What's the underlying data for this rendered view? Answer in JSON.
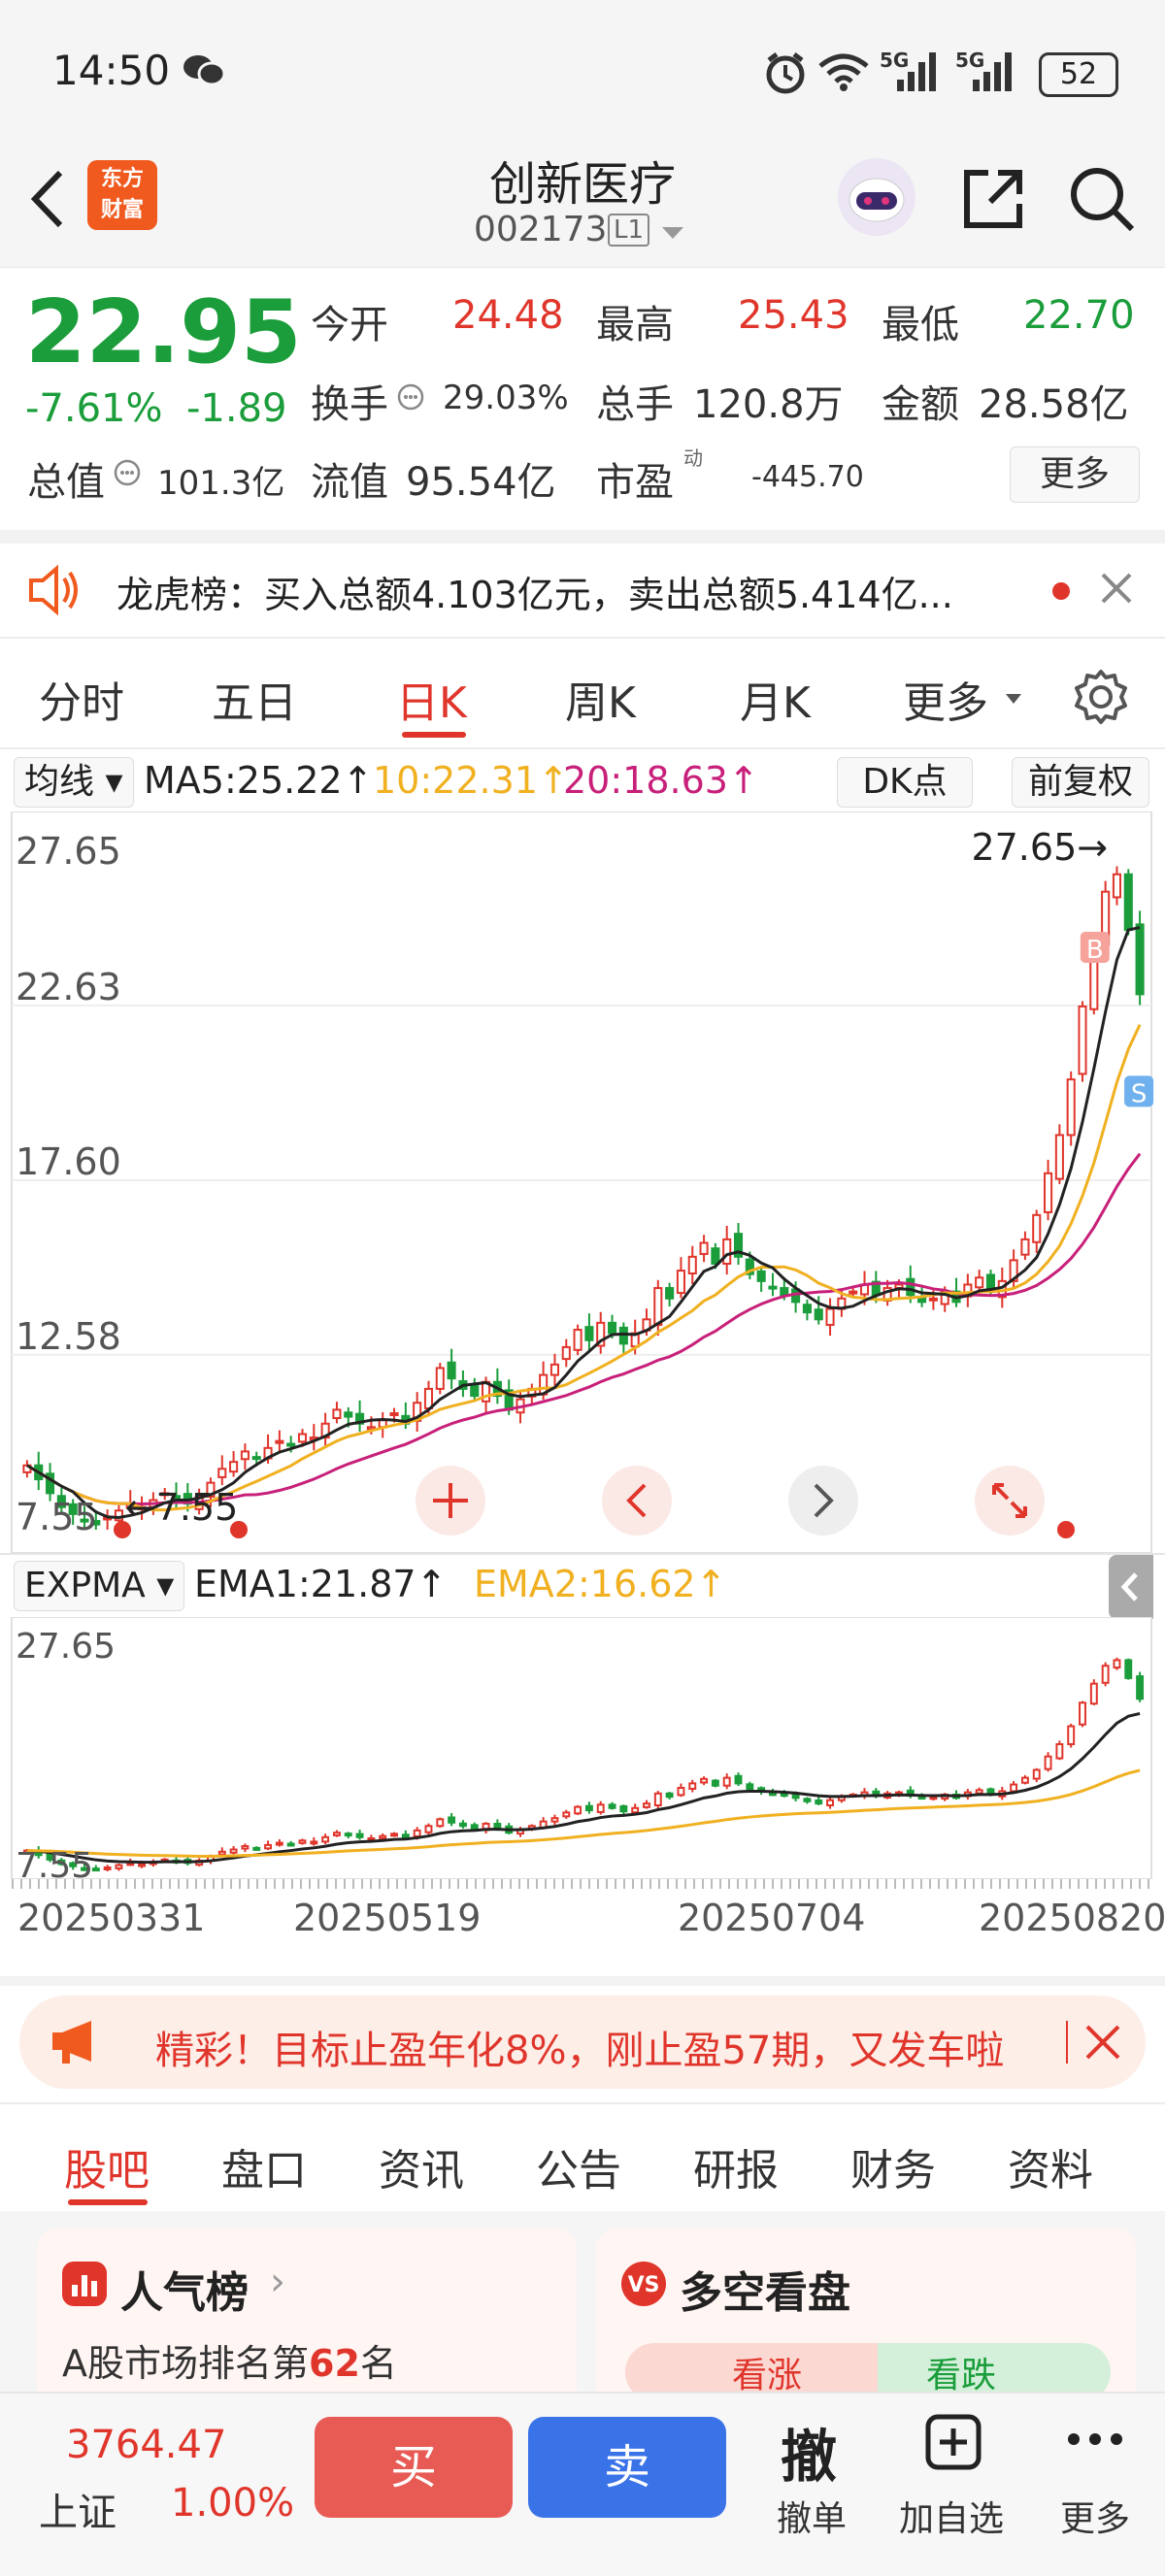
{
  "status_bar": {
    "time": "14:50",
    "network1": "5G",
    "network2": "5G",
    "battery": "52"
  },
  "header": {
    "logo_line1": "东方",
    "logo_line2": "财富",
    "stock_name": "创新医疗",
    "stock_code": "002173",
    "level_badge": "L1"
  },
  "quote": {
    "price": "22.95",
    "change_pct": "-7.61%",
    "change": "-1.89",
    "open_label": "今开",
    "open": "24.48",
    "high_label": "最高",
    "high": "25.43",
    "low_label": "最低",
    "low": "22.70",
    "turnover_label": "换手",
    "turnover": "29.03%",
    "volume_label": "总手",
    "volume": "120.8万",
    "amount_label": "金额",
    "amount": "28.58亿",
    "mktcap_label": "总值",
    "mktcap": "101.3亿",
    "float_label": "流值",
    "float_cap": "95.54亿",
    "pe_label": "市盈",
    "pe_sup": "动",
    "pe": "-445.70",
    "more_label": "更多"
  },
  "notice": {
    "text": "龙虎榜：买入总额4.103亿元，卖出总额5.414亿..."
  },
  "chart_tabs": {
    "items": [
      "分时",
      "五日",
      "日K",
      "周K",
      "月K",
      "更多"
    ],
    "active": 2
  },
  "ma_legend": {
    "selector": "均线",
    "ma5": "MA5:25.22↑",
    "ma10": "10:22.31↑",
    "ma20": "20:18.63↑",
    "dk": "DK点",
    "adjust": "前复权"
  },
  "colors": {
    "up": "#e0352b",
    "down": "#1a9d3a",
    "ma5": "#222222",
    "ma10": "#f0b020",
    "ma20": "#c8207a",
    "accent": "#e0352b",
    "blue": "#3a72e8"
  },
  "chart_data": {
    "type": "candlestick",
    "y_ticks": [
      "27.65",
      "22.63",
      "17.60",
      "12.58",
      "7.55"
    ],
    "ylim": [
      7.55,
      27.65
    ],
    "x_ticks": [
      "20250331",
      "20250519",
      "20250704",
      "20250820"
    ],
    "max_annotation": "27.65",
    "min_annotation": "7.55",
    "buy_marker": "B",
    "sell_marker": "S",
    "closes": [
      9.4,
      9.0,
      8.6,
      8.2,
      8.0,
      7.8,
      7.7,
      7.9,
      8.1,
      8.3,
      8.2,
      8.4,
      8.6,
      8.5,
      8.3,
      8.5,
      8.9,
      9.3,
      9.5,
      9.8,
      9.6,
      9.9,
      10.1,
      10.0,
      10.3,
      10.2,
      10.6,
      11.0,
      10.8,
      10.6,
      10.5,
      10.7,
      10.9,
      10.6,
      11.2,
      11.6,
      12.2,
      11.9,
      11.6,
      11.4,
      11.8,
      11.4,
      11.0,
      11.3,
      11.6,
      12.0,
      12.3,
      12.8,
      13.3,
      13.0,
      13.5,
      13.2,
      12.9,
      13.2,
      13.6,
      14.5,
      14.2,
      15.0,
      15.4,
      15.8,
      15.2,
      15.9,
      15.4,
      14.9,
      14.7,
      14.5,
      14.3,
      14.1,
      13.8,
      13.6,
      13.9,
      14.2,
      14.4,
      14.6,
      14.3,
      14.5,
      14.6,
      14.3,
      14.1,
      14.2,
      14.4,
      14.1,
      14.6,
      14.8,
      14.4,
      14.7,
      15.3,
      15.9,
      16.6,
      17.8,
      18.9,
      20.5,
      22.6,
      24.3,
      25.9,
      26.4,
      24.8,
      22.95
    ],
    "ma5_end": "25.22",
    "ma10_end": "22.31",
    "ma20_end": "18.63",
    "expma": {
      "selector": "EXPMA",
      "ema1": "EMA1:21.87↑",
      "ema2": "EMA2:16.62↑",
      "y_top": "27.65",
      "y_bottom": "7.55"
    }
  },
  "ad_banner": {
    "text": "精彩！目标止盈年化8%，刚止盈57期，又发车啦"
  },
  "bottom_tabs": {
    "items": [
      "股吧",
      "盘口",
      "资讯",
      "公告",
      "研报",
      "财务",
      "资料"
    ],
    "active": 0
  },
  "cards": {
    "popularity_title": "人气榜",
    "popularity_text_prefix": "A股市场排名第",
    "popularity_rank": "62",
    "popularity_suffix": "名",
    "sentiment_title": "多空看盘",
    "bull_label": "看涨",
    "bear_label": "看跌"
  },
  "footer": {
    "index_value": "3764.47",
    "index_name": "上证",
    "index_change": "1.00%",
    "buy_label": "买",
    "sell_label": "卖",
    "cancel_icon": "撤",
    "cancel_label": "撤单",
    "add_fav_label": "加自选",
    "more_label": "更多"
  }
}
